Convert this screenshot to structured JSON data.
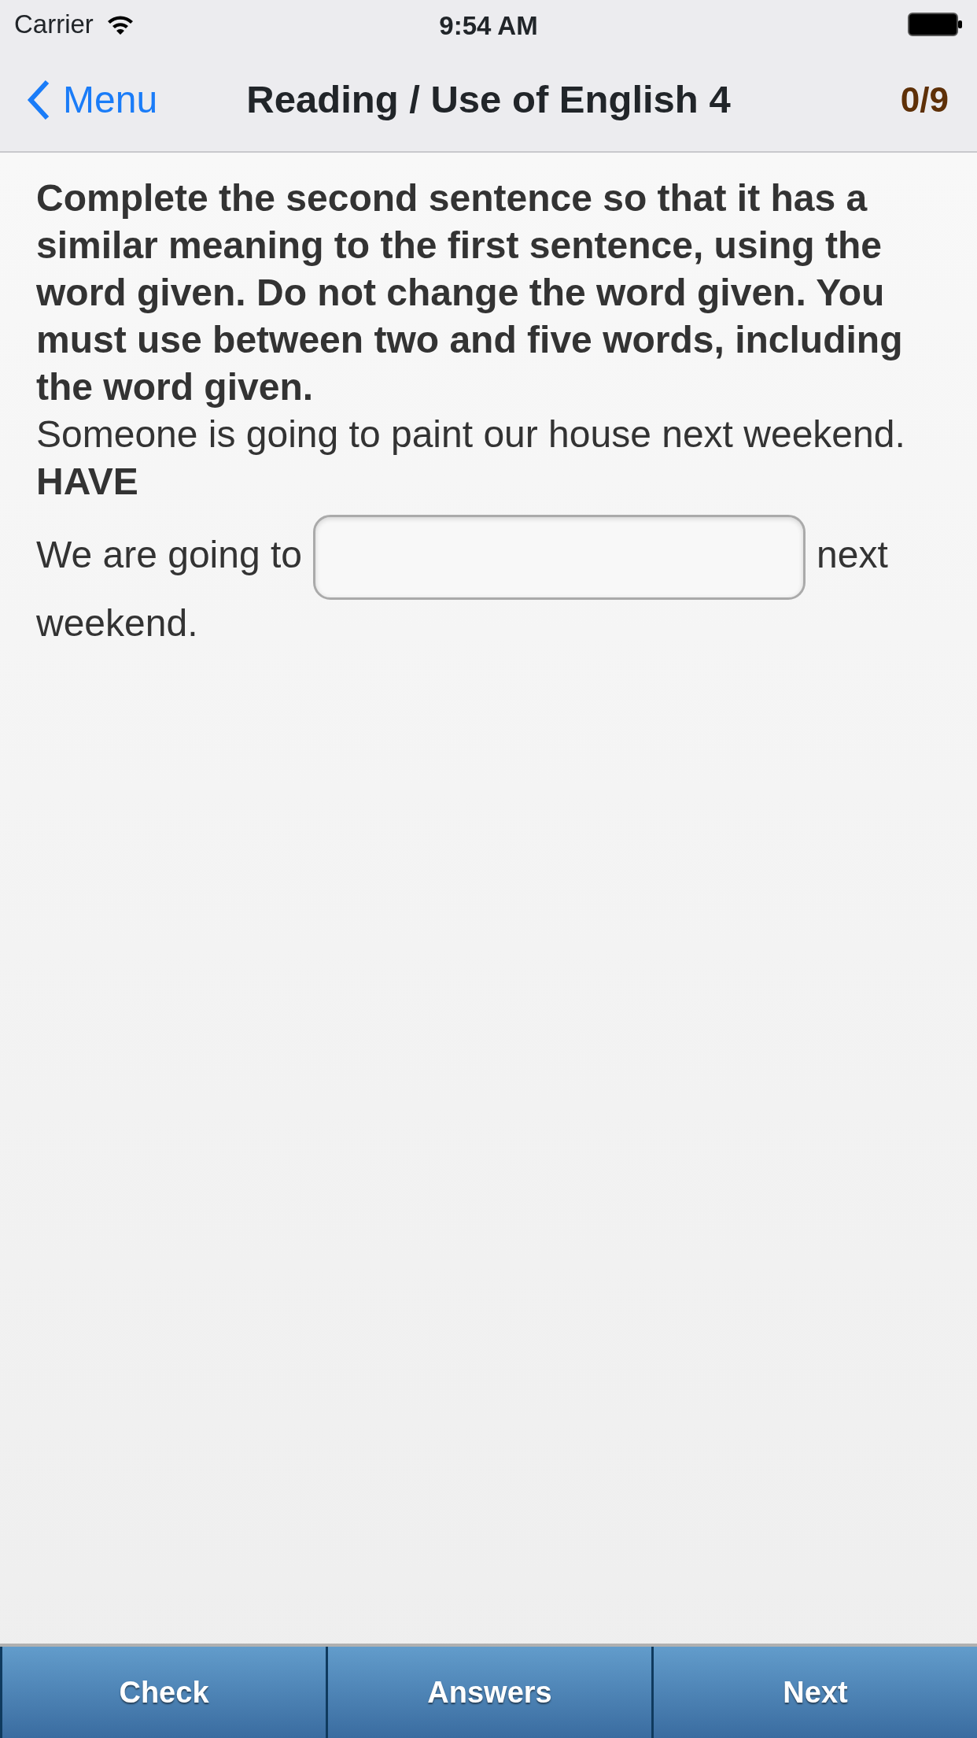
{
  "status_bar": {
    "carrier": "Carrier",
    "time": "9:54 AM"
  },
  "nav_bar": {
    "back": "Menu",
    "title": "Reading / Use of English 4",
    "score": "0/9"
  },
  "question": {
    "instruction": "Complete the second sentence so that it has a similar meaning to the first sentence, using the word given. Do not change the word given. You must use between two and five words, including the word given.",
    "sentence": "Someone is going to paint our house next weekend.",
    "key_word": "HAVE",
    "before": "We are going to",
    "after": "next",
    "after_wrap": "weekend."
  },
  "buttons": [
    {
      "label": "Check"
    },
    {
      "label": "Answers"
    },
    {
      "label": "Next"
    }
  ]
}
